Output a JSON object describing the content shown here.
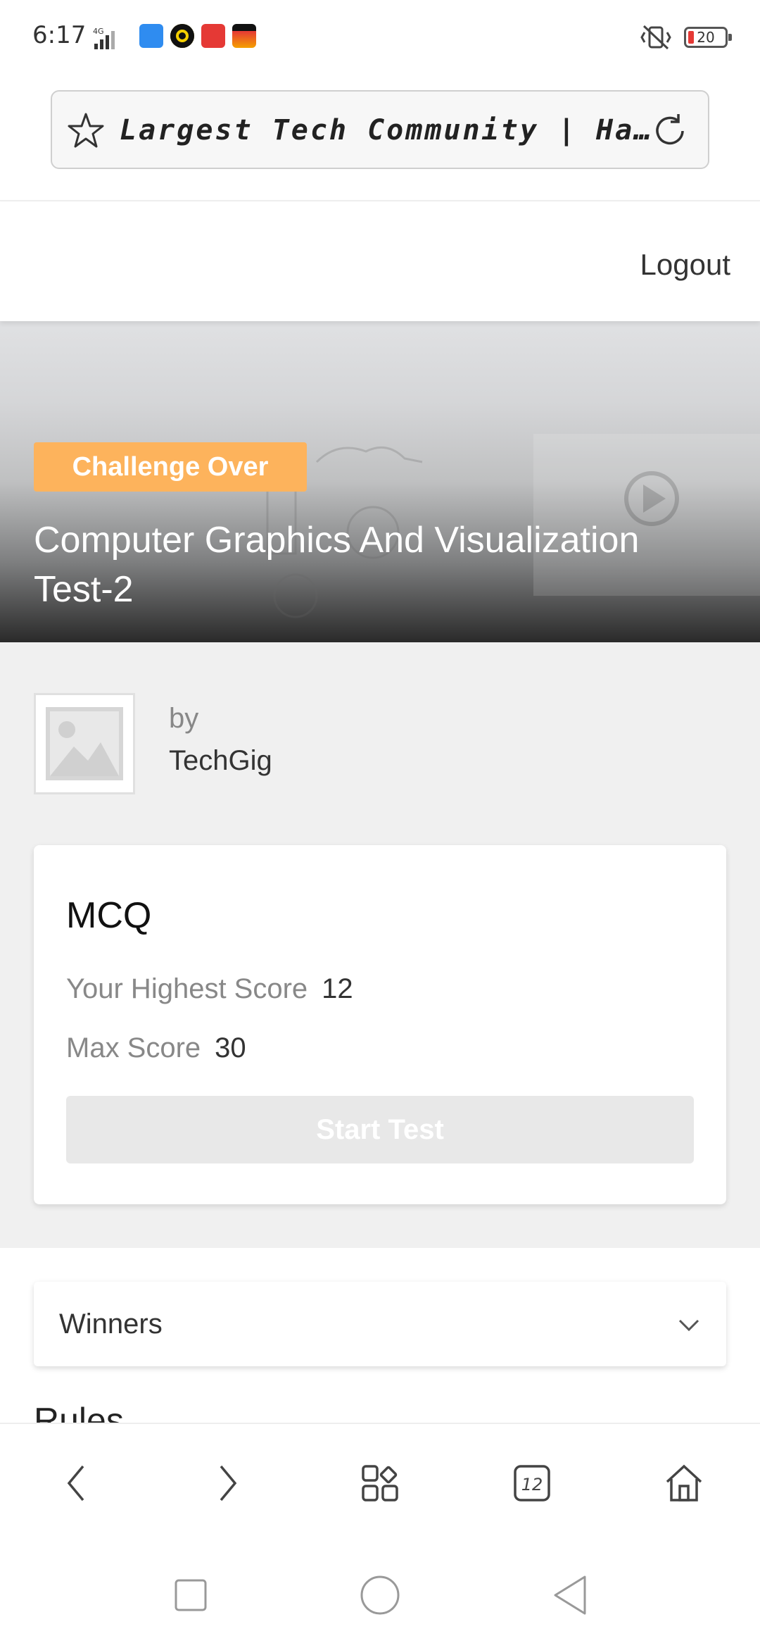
{
  "status_bar": {
    "time": "6:17",
    "network": "4G",
    "battery": "20"
  },
  "address_bar": {
    "title": "Largest Tech Community | Hackatho..."
  },
  "top_nav": {
    "logout_label": "Logout"
  },
  "hero": {
    "badge": "Challenge Over",
    "title": "Computer Graphics And Visualization Test-2"
  },
  "author": {
    "by_label": "by",
    "name": "TechGig"
  },
  "test_card": {
    "title": "MCQ",
    "highest_score_label": "Your Highest Score",
    "highest_score_value": "12",
    "max_score_label": "Max Score",
    "max_score_value": "30",
    "start_button": "Start Test"
  },
  "winners": {
    "label": "Winners"
  },
  "rules": {
    "heading": "Rules"
  },
  "browser_bar": {
    "tab_count": "12"
  },
  "colors": {
    "badge": "#fdb35c",
    "page_bg": "#f0f0f0",
    "button_disabled": "#e8e8e8"
  }
}
